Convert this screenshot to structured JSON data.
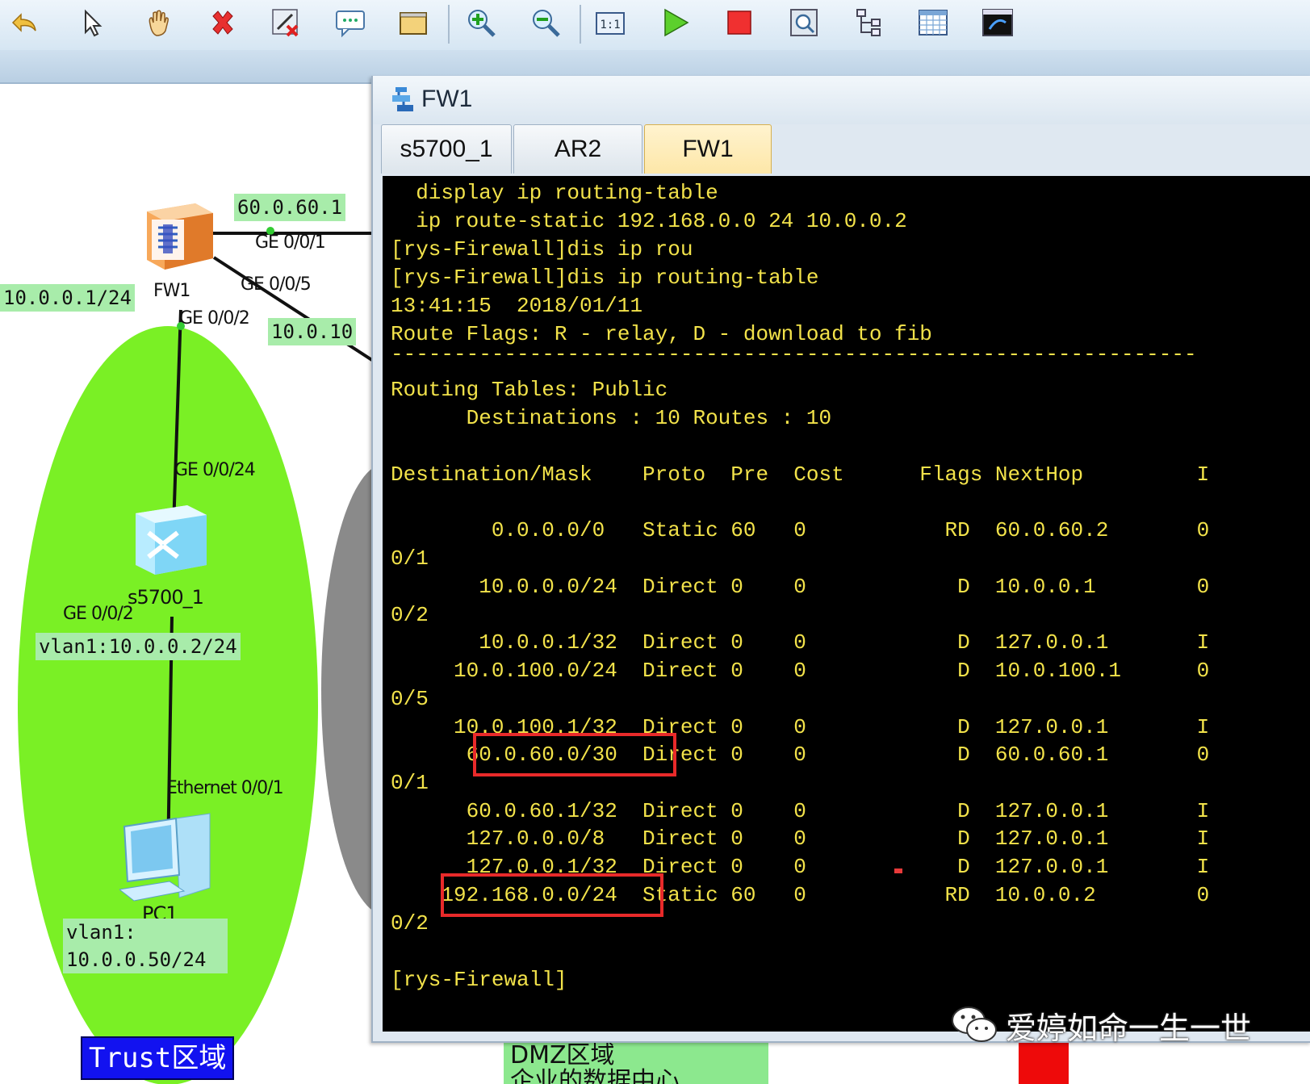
{
  "toolbar": {
    "icons": [
      "undo-icon",
      "pointer-icon",
      "hand-icon",
      "delete-icon",
      "remove-link-icon",
      "text-comment-icon",
      "rectangle-icon",
      "zoom-in-icon",
      "zoom-out-icon",
      "fit-window-icon",
      "start-device-icon",
      "stop-device-icon",
      "capture-icon",
      "topology-icon",
      "grid-icon",
      "cli-console-icon"
    ]
  },
  "topology": {
    "labels": {
      "ip_60": "60.0.60.1",
      "ip_10_0_0_1": "10.0.0.1/24",
      "ip_10_0_100": "10.0.10",
      "fw1_name": "FW1",
      "ge_0_0_1": "GE 0/0/1",
      "ge_0_0_5": "GE 0/0/5",
      "ge_0_0_2_fw": "GE 0/0/2",
      "ge_0_0_24": "GE 0/0/24",
      "switch_name": "s5700_1",
      "ge_0_0_2_sw": "GE 0/0/2",
      "vlan_switch": "vlan1:10.0.0.2/24",
      "eth_0_0_1": "Ethernet 0/0/1",
      "pc_name": "PC1",
      "pc_vlan": "vlan1:",
      "pc_ip": "10.0.0.50/24",
      "trust_zone": "Trust区域",
      "dmz_zone_line1": "DMZ区域",
      "dmz_zone_line2": "企业的数据中心"
    }
  },
  "cli": {
    "window_title": "FW1",
    "tabs": [
      "s5700_1",
      "AR2",
      "FW1"
    ],
    "active_tab": "FW1",
    "lines": [
      "  display ip routing-table",
      "  ip route-static 192.168.0.0 24 10.0.0.2",
      "[rys-Firewall]dis ip rou",
      "[rys-Firewall]dis ip routing-table",
      "13:41:15  2018/01/11",
      "Route Flags: R - relay, D - download to fib",
      "----------------------------------------------------------------",
      "Routing Tables: Public",
      "      Destinations : 10 Routes : 10",
      "",
      "Destination/Mask    Proto  Pre  Cost      Flags NextHop         I",
      "",
      "        0.0.0.0/0   Static 60   0           RD  60.0.60.2       0",
      "0/1",
      "       10.0.0.0/24  Direct 0    0            D  10.0.0.1        0",
      "0/2",
      "       10.0.0.1/32  Direct 0    0            D  127.0.0.1       I",
      "     10.0.100.0/24  Direct 0    0            D  10.0.100.1      0",
      "0/5",
      "     10.0.100.1/32  Direct 0    0            D  127.0.0.1       I",
      "      60.0.60.0/30  Direct 0    0            D  60.0.60.1       0",
      "0/1",
      "      60.0.60.1/32  Direct 0    0            D  127.0.0.1       I",
      "      127.0.0.0/8   Direct 0    0            D  127.0.0.1       I",
      "      127.0.0.1/32  Direct 0    0            D  127.0.0.1       I",
      "    192.168.0.0/24  Static 60   0           RD  10.0.0.2        0",
      "0/2",
      "",
      "[rys-Firewall]"
    ]
  },
  "watermark": {
    "text": "爱婷如命一生一世"
  },
  "colors": {
    "terminal_text": "#f2e24a",
    "highlight_box": "#e82a2a",
    "trust_zone": "#7af025",
    "trust_label_bg": "#1212f0"
  }
}
